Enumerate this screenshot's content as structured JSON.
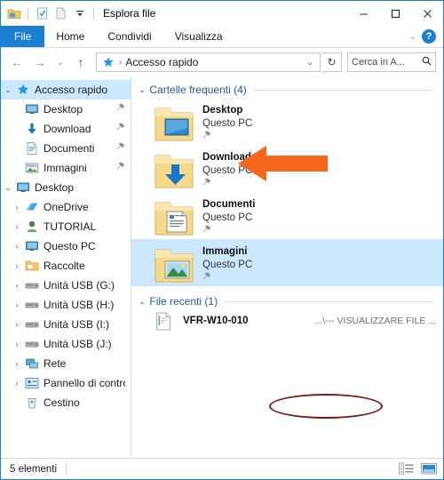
{
  "window": {
    "title": "Esplora file",
    "quick_access_toolbar": [
      {
        "name": "folder-icon",
        "label": "Esplora file"
      },
      {
        "name": "properties-icon",
        "label": "Proprietà"
      },
      {
        "name": "new-folder-icon",
        "label": "Nuova cartella"
      },
      {
        "name": "customize-dropdown-icon",
        "label": "Personalizza barra"
      }
    ],
    "controls": {
      "minimize": "─",
      "maximize": "□",
      "close": "✕"
    }
  },
  "ribbon": {
    "tabs": [
      {
        "label": "File",
        "active": true
      },
      {
        "label": "Home",
        "active": false
      },
      {
        "label": "Condividi",
        "active": false
      },
      {
        "label": "Visualizza",
        "active": false
      }
    ],
    "collapse_icon": "⌄",
    "help_icon": "?"
  },
  "addressbar": {
    "back_icon": "←",
    "forward_icon": "→",
    "recent_icon": "⌄",
    "up_icon": "↑",
    "star_icon": "star-icon",
    "separator": "›",
    "path": "Accesso rapido",
    "dropdown_icon": "⌄",
    "refresh_icon": "↻",
    "search_placeholder": "Cerca in A...",
    "search_icon": "⚲"
  },
  "sidebar": {
    "items": [
      {
        "label": "Accesso rapido",
        "icon": "star-icon",
        "twisty": "⌄",
        "level": 0,
        "selected": true,
        "pinned": false
      },
      {
        "label": "Desktop",
        "icon": "monitor-icon",
        "twisty": "",
        "level": 1,
        "selected": false,
        "pinned": true
      },
      {
        "label": "Download",
        "icon": "download-arrow-icon",
        "twisty": "",
        "level": 1,
        "selected": false,
        "pinned": true
      },
      {
        "label": "Documenti",
        "icon": "document-icon",
        "twisty": "",
        "level": 1,
        "selected": false,
        "pinned": true
      },
      {
        "label": "Immagini",
        "icon": "picture-icon",
        "twisty": "",
        "level": 1,
        "selected": false,
        "pinned": true
      },
      {
        "label": "Desktop",
        "icon": "monitor-icon",
        "twisty": "⌄",
        "level": 0,
        "selected": false,
        "pinned": false
      },
      {
        "label": "OneDrive",
        "icon": "cloud-icon",
        "twisty": "›",
        "level": 1,
        "selected": false,
        "pinned": false
      },
      {
        "label": "TUTORIAL",
        "icon": "user-icon",
        "twisty": "›",
        "level": 1,
        "selected": false,
        "pinned": false
      },
      {
        "label": "Questo PC",
        "icon": "monitor-icon",
        "twisty": "›",
        "level": 1,
        "selected": false,
        "pinned": false
      },
      {
        "label": "Raccolte",
        "icon": "library-icon",
        "twisty": "›",
        "level": 1,
        "selected": false,
        "pinned": false
      },
      {
        "label": "Unità USB (G:)",
        "icon": "drive-icon",
        "twisty": "›",
        "level": 1,
        "selected": false,
        "pinned": false
      },
      {
        "label": "Unità USB (H:)",
        "icon": "drive-icon",
        "twisty": "›",
        "level": 1,
        "selected": false,
        "pinned": false
      },
      {
        "label": "Unità USB (I:)",
        "icon": "drive-icon",
        "twisty": "›",
        "level": 1,
        "selected": false,
        "pinned": false
      },
      {
        "label": "Unità USB (J:)",
        "icon": "drive-icon",
        "twisty": "›",
        "level": 1,
        "selected": false,
        "pinned": false
      },
      {
        "label": "Rete",
        "icon": "network-icon",
        "twisty": "›",
        "level": 1,
        "selected": false,
        "pinned": false
      },
      {
        "label": "Pannello di controll",
        "icon": "control-panel-icon",
        "twisty": "›",
        "level": 1,
        "selected": false,
        "pinned": false
      },
      {
        "label": "Cestino",
        "icon": "recycle-bin-icon",
        "twisty": "",
        "level": 1,
        "selected": false,
        "pinned": false
      }
    ],
    "pin_glyph": "📌"
  },
  "main": {
    "groups": [
      {
        "title": "Cartelle frequenti (4)",
        "chevron": "⌄",
        "tiles": [
          {
            "name": "Desktop",
            "subtitle": "Questo PC",
            "icon": "folder-desktop-icon",
            "selected": false,
            "pinned": true
          },
          {
            "name": "Download",
            "subtitle": "Questo PC",
            "icon": "folder-download-icon",
            "selected": false,
            "pinned": true
          },
          {
            "name": "Documenti",
            "subtitle": "Questo PC",
            "icon": "folder-documents-icon",
            "selected": false,
            "pinned": true
          },
          {
            "name": "Immagini",
            "subtitle": "Questo PC",
            "icon": "folder-pictures-icon",
            "selected": true,
            "pinned": true
          }
        ]
      }
    ],
    "recent": {
      "title": "File recenti (1)",
      "chevron": "⌄",
      "rows": [
        {
          "name": "VFR-W10-010",
          "path": "...\\--- VISUALIZZARE FILE ...",
          "icon": "document-file-icon"
        }
      ]
    }
  },
  "statusbar": {
    "item_count": "5 elementi",
    "view_details_icon": "details-view-icon",
    "view_tiles_icon": "large-icons-view-icon"
  },
  "annotations": {
    "arrow_color": "#f4671c",
    "ellipse_color": "#7d1a1a",
    "arrow_target": "Accesso rapido",
    "ellipse_target": "File recenti (1)"
  }
}
